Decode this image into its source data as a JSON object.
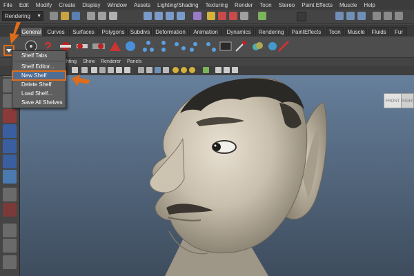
{
  "menubar": {
    "items": [
      "File",
      "Edit",
      "Modify",
      "Create",
      "Display",
      "Window",
      "Assets",
      "Lighting/Shading",
      "Texturing",
      "Render",
      "Toon",
      "Stereo",
      "Paint Effects",
      "Muscle",
      "Help"
    ]
  },
  "statusline": {
    "menu_set": "Rendering"
  },
  "shelf_tabs": {
    "items": [
      "General",
      "Curves",
      "Surfaces",
      "Polygons",
      "Subdivs",
      "Deformation",
      "Animation",
      "Dynamics",
      "Rendering",
      "PaintEffects",
      "Toon",
      "Muscle",
      "Fluids",
      "Fur"
    ],
    "active": "General"
  },
  "panel_menu": {
    "items": [
      "Lighting",
      "Show",
      "Renderer",
      "Panels"
    ],
    "partial_first": "ghting"
  },
  "shelf_menu": {
    "items": [
      "Shelf Tabs",
      "Shelf Editor...",
      "New Shelf",
      "Delete Shelf",
      "Load Shelf...",
      "Save All Shelves"
    ],
    "highlighted": "New Shelf"
  },
  "viewcube": {
    "front": "FRONT",
    "right": "RIGHT"
  },
  "colors": {
    "accent": "#e06c1a",
    "highlight": "#4f6d93",
    "viewport_top": "#667f9b",
    "viewport_bottom": "#3e4c5d"
  }
}
